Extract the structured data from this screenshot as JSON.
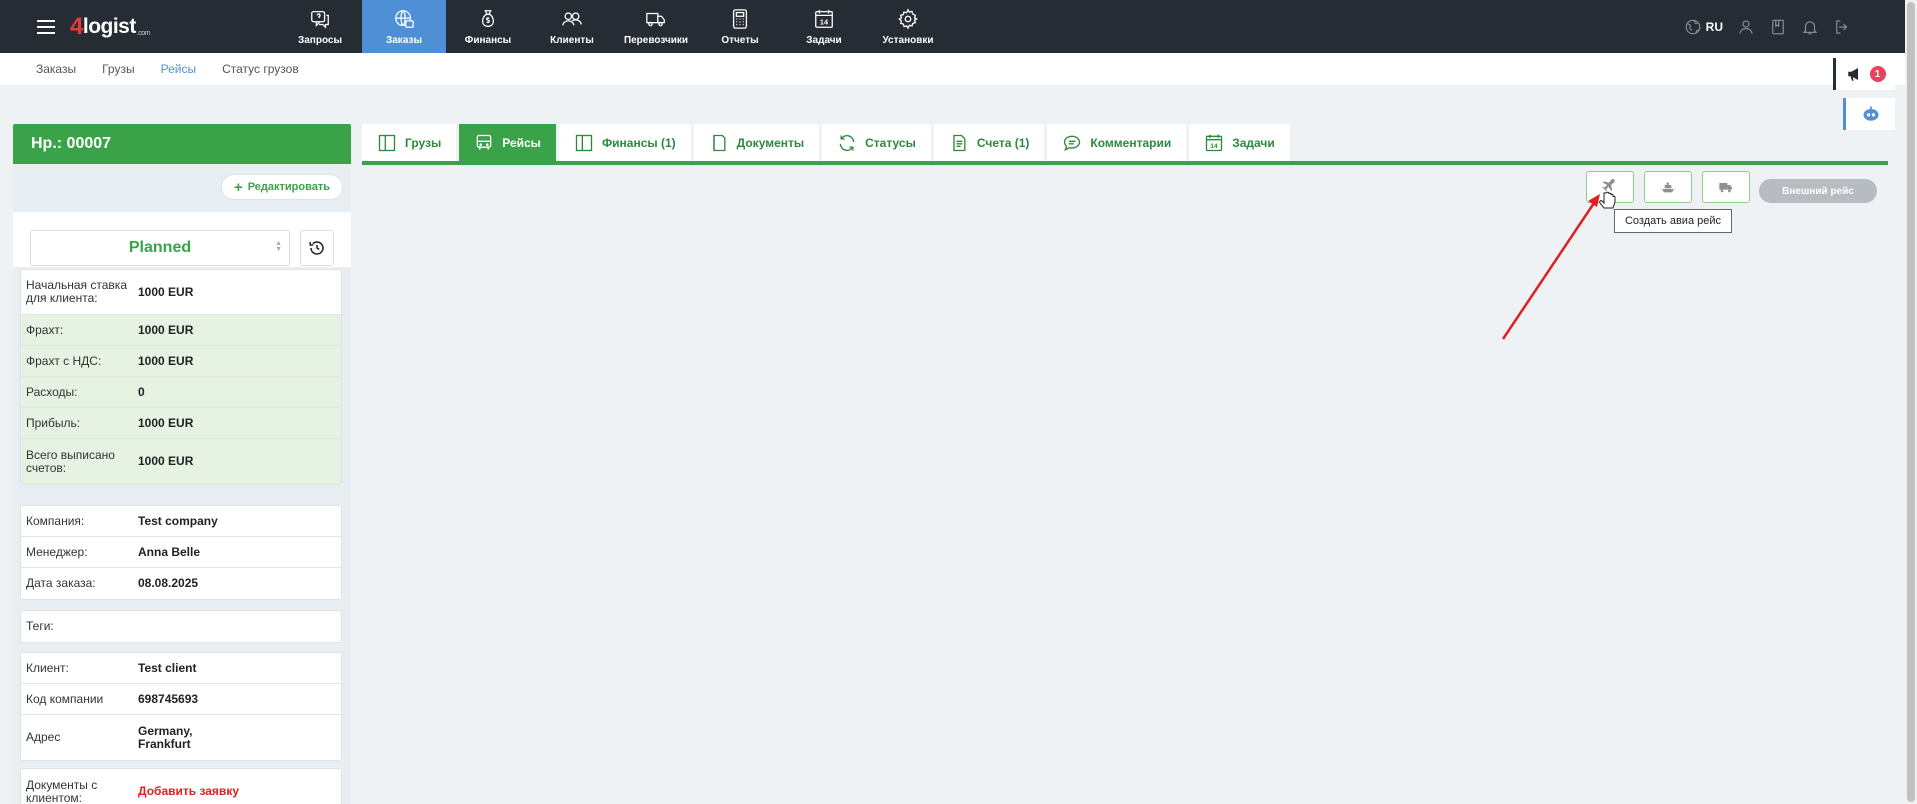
{
  "brand": {
    "logo_prefix": "4",
    "logo_text": "logist",
    "logo_suffix": ".com"
  },
  "nav": {
    "items": [
      {
        "label": "Запросы",
        "icon": "question-chat-icon"
      },
      {
        "label": "Заказы",
        "icon": "globe-cart-icon",
        "active": true
      },
      {
        "label": "Финансы",
        "icon": "money-bag-icon"
      },
      {
        "label": "Клиенты",
        "icon": "users-icon"
      },
      {
        "label": "Перевозчики",
        "icon": "truck-icon"
      },
      {
        "label": "Отчеты",
        "icon": "calculator-icon"
      },
      {
        "label": "Задачи",
        "icon": "calendar-icon"
      },
      {
        "label": "Установки",
        "icon": "gear-icon"
      }
    ],
    "language": "RU"
  },
  "subnav": {
    "items": [
      "Заказы",
      "Грузы",
      "Рейсы",
      "Статус грузов"
    ],
    "active_index": 2
  },
  "announce": {
    "badge": "1"
  },
  "order": {
    "title": "Нр.: 00007",
    "edit_label": "Редактировать",
    "status": "Planned"
  },
  "finance": [
    {
      "label": "Начальная ставка для клиента:",
      "value": "1000 EUR"
    },
    {
      "label": "Фрахт:",
      "value": "1000 EUR"
    },
    {
      "label": "Фрахт с НДС:",
      "value": "1000 EUR"
    },
    {
      "label": "Расходы:",
      "value": "0"
    },
    {
      "label": "Прибыль:",
      "value": "1000 EUR"
    },
    {
      "label": "Всего выписано счетов:",
      "value": "1000 EUR"
    }
  ],
  "company_info": [
    {
      "label": "Компания:",
      "value": "Test company"
    },
    {
      "label": "Менеджер:",
      "value": "Anna Belle"
    },
    {
      "label": "Дата заказа:",
      "value": "08.08.2025"
    }
  ],
  "tags": {
    "label": "Теги:",
    "value": ""
  },
  "client_info": [
    {
      "label": "Клиент:",
      "value": "Test client"
    },
    {
      "label": "Код компании",
      "value": "698745693"
    },
    {
      "label": "Адрес",
      "value": "Germany, Frankfurt"
    }
  ],
  "documents": {
    "label": "Документы с клиентом:",
    "value": "Добавить заявку"
  },
  "tabs": [
    {
      "label": "Грузы",
      "icon": "columns-icon"
    },
    {
      "label": "Рейсы",
      "icon": "bus-icon",
      "active": true
    },
    {
      "label": "Финансы (1)",
      "icon": "columns-icon"
    },
    {
      "label": "Документы",
      "icon": "document-icon"
    },
    {
      "label": "Статусы",
      "icon": "refresh-icon"
    },
    {
      "label": "Счета (1)",
      "icon": "invoice-icon"
    },
    {
      "label": "Комментарии",
      "icon": "comment-icon"
    },
    {
      "label": "Задачи",
      "icon": "calendar-icon"
    }
  ],
  "actions": {
    "air_icon": "plane-icon",
    "sea_icon": "ship-icon",
    "road_icon": "truck-icon",
    "external_label": "Внешний рейс",
    "tooltip": "Создать авиа рейс"
  },
  "colors": {
    "primary_green": "#3aa34a",
    "nav_bg": "#262c33",
    "nav_active": "#4f8fd6",
    "badge": "#e8425c",
    "annotation_arrow": "#e02020"
  }
}
